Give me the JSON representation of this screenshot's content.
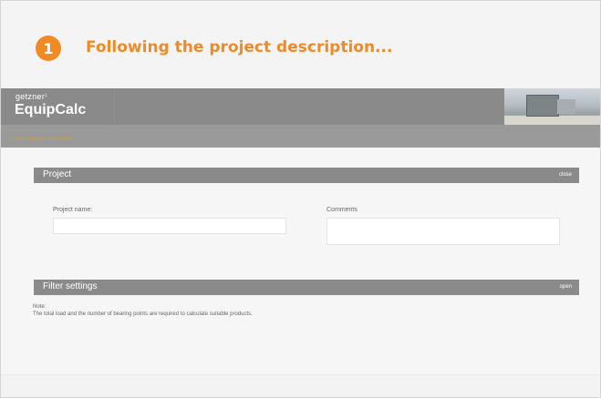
{
  "step": {
    "number": "1",
    "title": "Following the project description..."
  },
  "header": {
    "brand_small": "getzner⁾",
    "app_name": "EquipCalc",
    "back_link": "back to projects overview"
  },
  "project_section": {
    "title": "Project",
    "action": "close",
    "name_label": "Project name:",
    "name_value": "",
    "comments_label": "Comments",
    "comments_value": ""
  },
  "filter_section": {
    "title": "Filter settings",
    "action": "open"
  },
  "note": {
    "label": "Note:",
    "text": "The total load and the number of bearing points are required to calculate suitable products."
  },
  "colors": {
    "accent": "#f08a24",
    "bar": "#8a8a8a"
  }
}
